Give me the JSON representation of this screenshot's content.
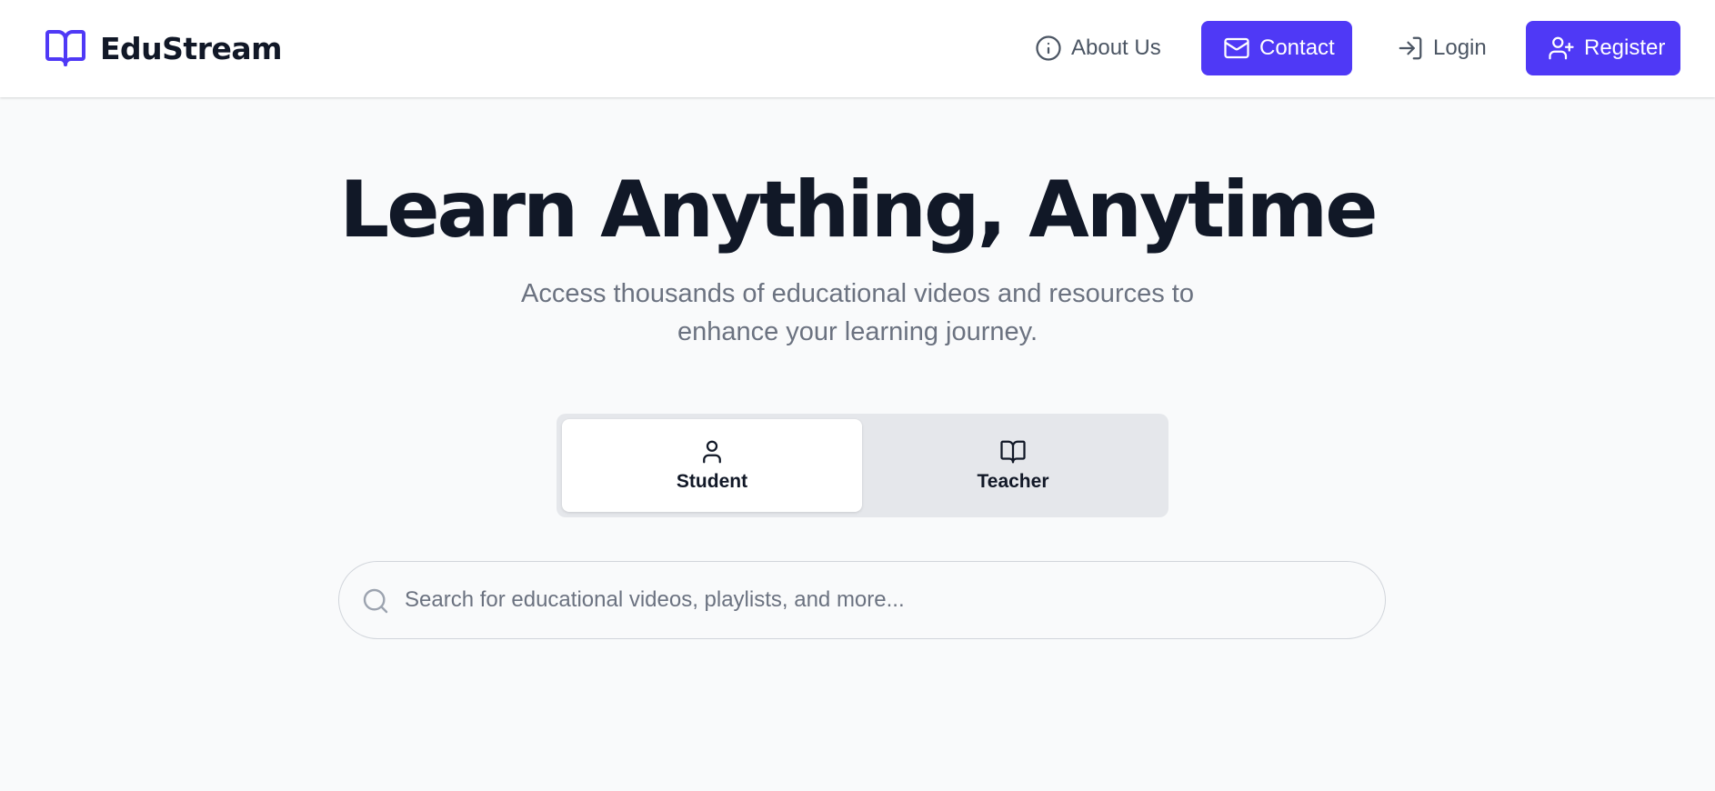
{
  "brand": {
    "name": "EduStream",
    "icon": "book-open-icon",
    "color": "#4f39f6"
  },
  "nav": {
    "about": {
      "label": "About Us",
      "icon": "info-icon"
    },
    "contact": {
      "label": "Contact",
      "icon": "mail-icon"
    },
    "login": {
      "label": "Login",
      "icon": "log-in-icon"
    },
    "register": {
      "label": "Register",
      "icon": "user-plus-icon"
    }
  },
  "hero": {
    "title": "Learn Anything, Anytime",
    "subtitle_line1": "Access thousands of educational videos and resources to",
    "subtitle_line2": "enhance your learning journey."
  },
  "roles": {
    "selected": "Student",
    "options": [
      {
        "label": "Student",
        "icon": "user-icon"
      },
      {
        "label": "Teacher",
        "icon": "book-open-icon"
      }
    ]
  },
  "search": {
    "placeholder": "Search for educational videos, playlists, and more...",
    "value": "",
    "icon": "search-icon"
  },
  "colors": {
    "accent": "#4f39f6",
    "background": "#f9fafb",
    "heading": "#111827",
    "muted": "#6b7280"
  }
}
